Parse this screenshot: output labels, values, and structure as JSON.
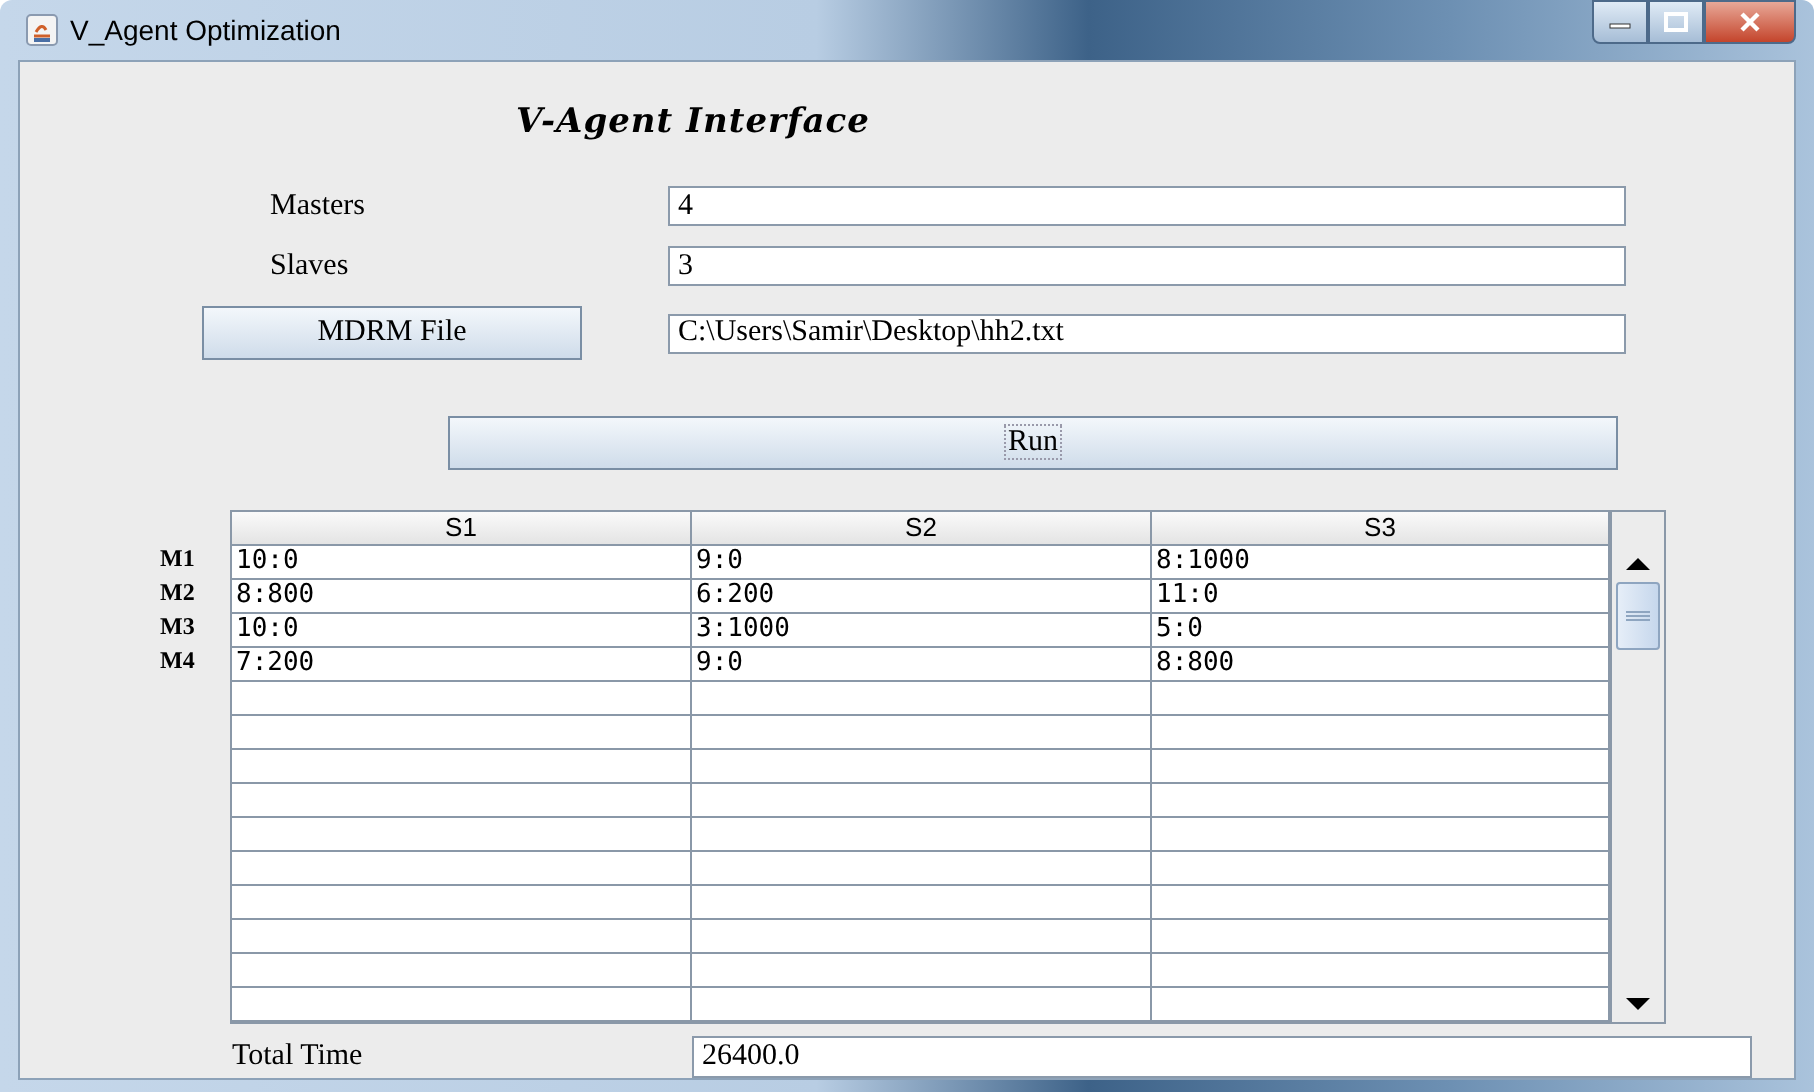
{
  "window": {
    "title": "V_Agent Optimization"
  },
  "heading": "V-Agent Interface",
  "fields": [
    {
      "kind": "label",
      "label": "Masters",
      "value": "4"
    },
    {
      "kind": "label",
      "label": "Slaves",
      "value": "3"
    },
    {
      "kind": "button",
      "label": "MDRM File",
      "value": "C:\\Users\\Samir\\Desktop\\hh2.txt"
    }
  ],
  "run_button": "Run",
  "table": {
    "columns": [
      "S1",
      "S2",
      "S3"
    ],
    "rows": [
      {
        "label": "M1",
        "cells": [
          "10:0",
          "9:0",
          "8:1000"
        ]
      },
      {
        "label": "M2",
        "cells": [
          "8:800",
          "6:200",
          "11:0"
        ]
      },
      {
        "label": "M3",
        "cells": [
          "10:0",
          "3:1000",
          "5:0"
        ]
      },
      {
        "label": "M4",
        "cells": [
          "7:200",
          "9:0",
          "8:800"
        ]
      }
    ]
  },
  "total": {
    "label": "Total Time",
    "value": "26400.0"
  }
}
